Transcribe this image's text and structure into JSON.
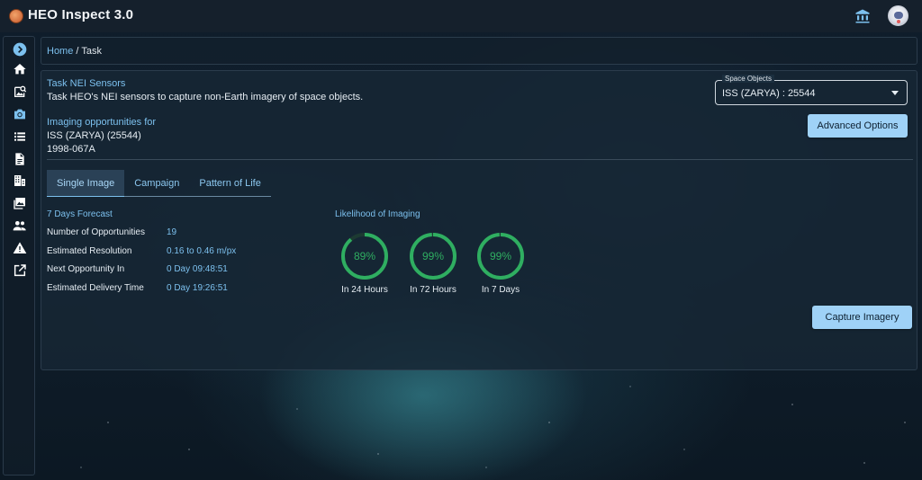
{
  "app": {
    "title": "HEO Inspect 3.0"
  },
  "breadcrumb": {
    "home": "Home",
    "separator": "/",
    "current": "Task"
  },
  "task": {
    "title": "Task NEI Sensors",
    "description": "Task HEO's NEI sensors to capture non-Earth imagery of space objects."
  },
  "opportunities": {
    "title": "Imaging opportunities for",
    "object_name": "ISS (ZARYA) (25544)",
    "object_id": "1998-067A"
  },
  "space_objects": {
    "label": "Space Objects",
    "selected": "ISS (ZARYA) : 25544"
  },
  "buttons": {
    "advanced": "Advanced Options",
    "capture": "Capture Imagery"
  },
  "tabs": [
    {
      "label": "Single Image",
      "active": true
    },
    {
      "label": "Campaign",
      "active": false
    },
    {
      "label": "Pattern of Life",
      "active": false
    }
  ],
  "forecast": {
    "title": "7 Days Forecast",
    "rows": [
      {
        "label": "Number of Opportunities",
        "value": "19"
      },
      {
        "label": "Estimated Resolution",
        "value": "0.16 to 0.46 m/px"
      },
      {
        "label": "Next Opportunity In",
        "value": "0 Day 09:48:51"
      },
      {
        "label": "Estimated Delivery Time",
        "value": "0 Day 19:26:51"
      }
    ]
  },
  "likelihood": {
    "title": "Likelihood of Imaging",
    "gauges": [
      {
        "value": 89,
        "text": "89%",
        "label": "In 24 Hours"
      },
      {
        "value": 99,
        "text": "99%",
        "label": "In 72 Hours"
      },
      {
        "value": 99,
        "text": "99%",
        "label": "In 7 Days"
      }
    ]
  },
  "colors": {
    "accent": "#7cc0ee",
    "button": "#9fd2f7",
    "gauge": "#2fae61"
  },
  "sidebar": {
    "icons": [
      "chevron-right-icon",
      "home-icon",
      "image-search-icon",
      "camera-icon",
      "list-icon",
      "document-icon",
      "building-icon",
      "images-icon",
      "people-icon",
      "warning-icon",
      "external-link-icon"
    ]
  }
}
